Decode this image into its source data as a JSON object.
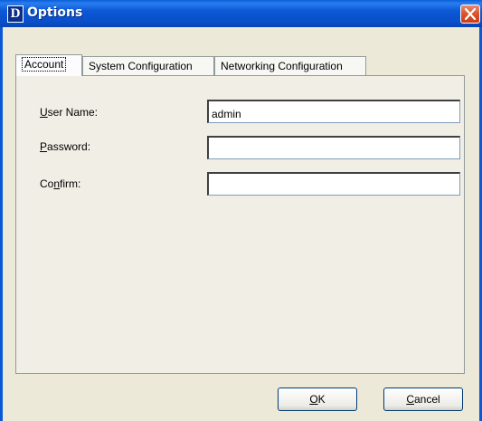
{
  "window": {
    "title": "Options",
    "app_icon_letter": "D"
  },
  "tabs": [
    {
      "label": "Account",
      "active": true
    },
    {
      "label": "System Configuration",
      "active": false
    },
    {
      "label": "Networking Configuration",
      "active": false
    }
  ],
  "account": {
    "username_label": {
      "mnemonic": "U",
      "rest": "ser Name:"
    },
    "username_value": "admin",
    "password_label": {
      "mnemonic": "P",
      "rest": "assword:"
    },
    "password_value": "",
    "confirm_label": {
      "prefix": "Co",
      "mnemonic": "n",
      "rest": "firm:"
    },
    "confirm_value": ""
  },
  "buttons": {
    "ok": {
      "mnemonic": "O",
      "rest": "K"
    },
    "cancel": {
      "mnemonic": "C",
      "rest": "ancel"
    }
  },
  "colors": {
    "titlebar": "#0b58d6",
    "dialog_bg": "#ece9d8",
    "close_button": "#d9532b"
  }
}
